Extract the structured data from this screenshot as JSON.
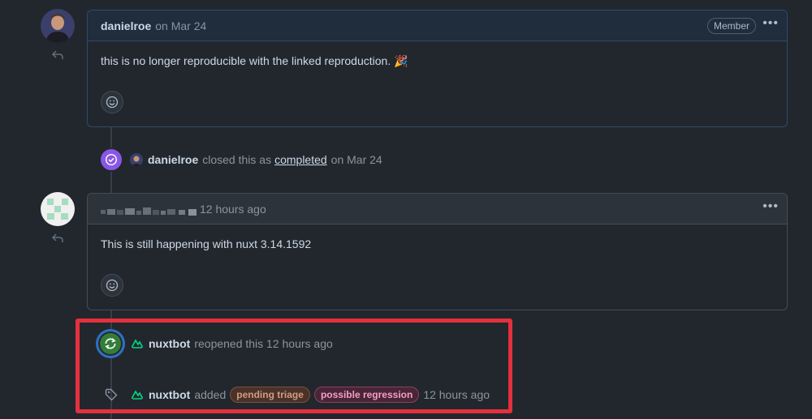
{
  "comment1": {
    "author": "danielroe",
    "meta": "on Mar 24",
    "badge": "Member",
    "body": "this is no longer reproducible with the linked reproduction. 🎉"
  },
  "close_event": {
    "actor": "danielroe",
    "text1": "closed this as",
    "link": "completed",
    "text2": "on Mar 24"
  },
  "comment2": {
    "meta": "12 hours ago",
    "body": "This is still happening with nuxt 3.14.1592"
  },
  "reopen_event": {
    "actor": "nuxtbot",
    "text": "reopened this 12 hours ago"
  },
  "label_event": {
    "actor": "nuxtbot",
    "text": "added",
    "labels": [
      {
        "name": "pending triage",
        "color": "#d29b82",
        "bg": "#4a3229",
        "border": "#7a5040"
      },
      {
        "name": "possible regression",
        "color": "#f0a0c8",
        "bg": "#4a2535",
        "border": "#8a4060"
      }
    ],
    "time": "12 hours ago"
  },
  "colors": {
    "highlight": "#e5303d",
    "closed_purple": "#8957e5",
    "reopen_green": "#347d39"
  }
}
